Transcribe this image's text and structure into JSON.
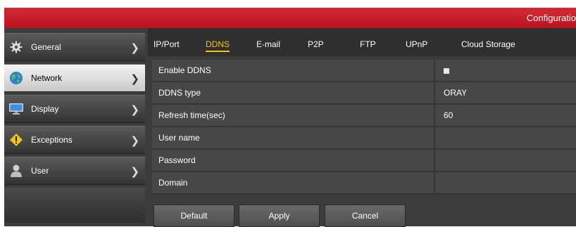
{
  "window": {
    "title": "Configuratio"
  },
  "sidebar": {
    "items": [
      {
        "label": "General",
        "icon": "gear-icon",
        "active": false
      },
      {
        "label": "Network",
        "icon": "globe-icon",
        "active": true
      },
      {
        "label": "Display",
        "icon": "monitor-icon",
        "active": false
      },
      {
        "label": "Exceptions",
        "icon": "warning-icon",
        "active": false
      },
      {
        "label": "User",
        "icon": "user-icon",
        "active": false
      }
    ]
  },
  "tabs": [
    "IP/Port",
    "DDNS",
    "E-mail",
    "P2P",
    "FTP",
    "UPnP",
    "Cloud Storage"
  ],
  "active_tab": "DDNS",
  "form": {
    "enable_ddns": {
      "label": "Enable DDNS",
      "checked": true
    },
    "ddns_type": {
      "label": "DDNS type",
      "value": "ORAY"
    },
    "refresh_time": {
      "label": "Refresh time(sec)",
      "value": "60"
    },
    "user_name": {
      "label": "User name",
      "value": ""
    },
    "password": {
      "label": "Password",
      "value": ""
    },
    "domain": {
      "label": "Domain",
      "value": ""
    }
  },
  "buttons": {
    "default": "Default",
    "apply": "Apply",
    "cancel": "Cancel"
  },
  "colors": {
    "titlebar": "#c21d26",
    "accent": "#f4c31a",
    "panel": "#3c3c3c"
  }
}
